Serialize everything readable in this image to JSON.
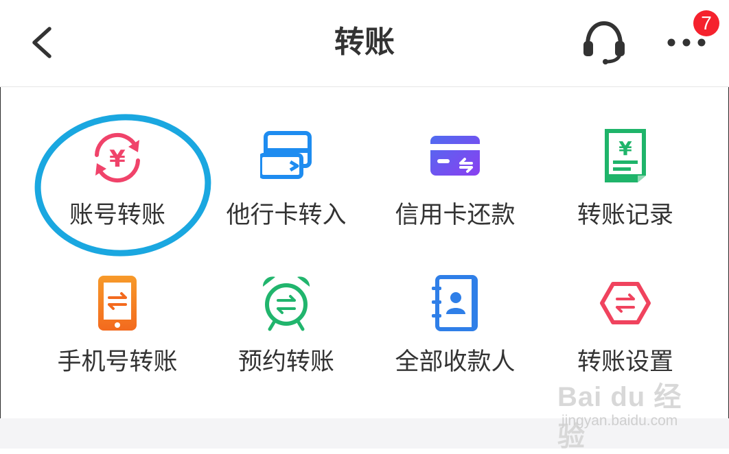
{
  "header": {
    "title": "转账",
    "back_icon": "chevron-left-icon",
    "service_icon": "headset-icon",
    "more_icon": "more-dots-icon",
    "notification_count": "7"
  },
  "grid": {
    "items": [
      {
        "label": "账号转账",
        "icon": "yuan-cycle-icon",
        "color": "#f0436a"
      },
      {
        "label": "他行卡转入",
        "icon": "card-transfer-in-icon",
        "color": "#1e8cf0"
      },
      {
        "label": "信用卡还款",
        "icon": "credit-card-repay-icon",
        "color": "#6a4ef0"
      },
      {
        "label": "转账记录",
        "icon": "yuan-receipt-icon",
        "color": "#1fb46a"
      },
      {
        "label": "手机号转账",
        "icon": "phone-transfer-icon",
        "color": "#f77c24"
      },
      {
        "label": "预约转账",
        "icon": "alarm-clock-transfer-icon",
        "color": "#21b56d"
      },
      {
        "label": "全部收款人",
        "icon": "contacts-book-icon",
        "color": "#2f7fe8"
      },
      {
        "label": "转账设置",
        "icon": "hexagon-transfer-icon",
        "color": "#f0435e"
      }
    ]
  },
  "watermark": {
    "logo_text": "Bai du 经验",
    "sub_text": "jingyan.baidu.com"
  }
}
